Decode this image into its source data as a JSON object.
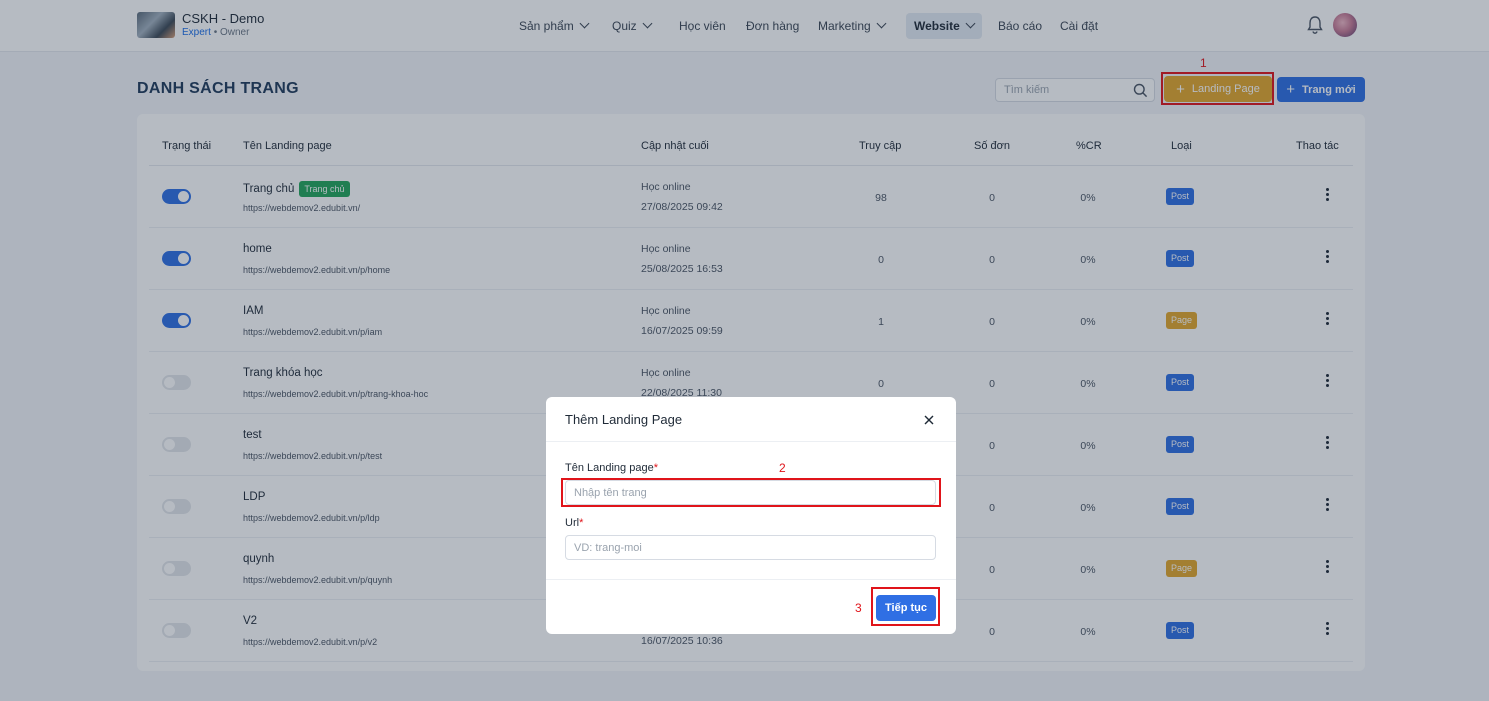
{
  "header": {
    "brand_name": "CSKH - Demo",
    "brand_plan": "Expert",
    "brand_role": "• Owner",
    "nav": [
      {
        "label": "Sản phẩm",
        "has_dropdown": true,
        "active": false
      },
      {
        "label": "Quiz",
        "has_dropdown": true,
        "active": false
      },
      {
        "label": "Học viên",
        "has_dropdown": false,
        "active": false
      },
      {
        "label": "Đơn hàng",
        "has_dropdown": false,
        "active": false
      },
      {
        "label": "Marketing",
        "has_dropdown": true,
        "active": false
      },
      {
        "label": "Website",
        "has_dropdown": true,
        "active": true
      },
      {
        "label": "Báo cáo",
        "has_dropdown": false,
        "active": false
      },
      {
        "label": "Cài đặt",
        "has_dropdown": false,
        "active": false
      }
    ],
    "icons": {
      "notifications": "bell-icon",
      "user": "avatar"
    }
  },
  "page": {
    "title": "DANH SÁCH TRANG",
    "search_placeholder": "Tìm kiếm",
    "btn_landing_page": "Landing Page",
    "btn_new_page": "Trang mới"
  },
  "table": {
    "columns": [
      "Trạng thái",
      "Tên Landing page",
      "Cập nhật cuối",
      "Truy cập",
      "Số đơn",
      "%CR",
      "Loại",
      "Thao tác"
    ],
    "rows": [
      {
        "enabled": true,
        "name": "Trang chủ",
        "badge": "Trang chủ",
        "url": "https://webdemov2.edubit.vn/",
        "updated_by": "Học online",
        "updated_at": "27/08/2025 09:42",
        "visits": "98",
        "orders": "0",
        "cr": "0%",
        "type": "Post"
      },
      {
        "enabled": true,
        "name": "home",
        "badge": "",
        "url": "https://webdemov2.edubit.vn/p/home",
        "updated_by": "Học online",
        "updated_at": "25/08/2025 16:53",
        "visits": "0",
        "orders": "0",
        "cr": "0%",
        "type": "Post"
      },
      {
        "enabled": true,
        "name": "IAM",
        "badge": "",
        "url": "https://webdemov2.edubit.vn/p/iam",
        "updated_by": "Học online",
        "updated_at": "16/07/2025 09:59",
        "visits": "1",
        "orders": "0",
        "cr": "0%",
        "type": "Page"
      },
      {
        "enabled": false,
        "name": "Trang khóa học",
        "badge": "",
        "url": "https://webdemov2.edubit.vn/p/trang-khoa-hoc",
        "updated_by": "Học online",
        "updated_at": "22/08/2025 11:30",
        "visits": "0",
        "orders": "0",
        "cr": "0%",
        "type": "Post"
      },
      {
        "enabled": false,
        "name": "test",
        "badge": "",
        "url": "https://webdemov2.edubit.vn/p/test",
        "updated_by": "",
        "updated_at": "",
        "visits": "",
        "orders": "0",
        "cr": "0%",
        "type": "Post"
      },
      {
        "enabled": false,
        "name": "LDP",
        "badge": "",
        "url": "https://webdemov2.edubit.vn/p/ldp",
        "updated_by": "",
        "updated_at": "",
        "visits": "",
        "orders": "0",
        "cr": "0%",
        "type": "Post"
      },
      {
        "enabled": false,
        "name": "quynh",
        "badge": "",
        "url": "https://webdemov2.edubit.vn/p/quynh",
        "updated_by": "",
        "updated_at": "",
        "visits": "",
        "orders": "0",
        "cr": "0%",
        "type": "Page"
      },
      {
        "enabled": false,
        "name": "V2",
        "badge": "",
        "url": "https://webdemov2.edubit.vn/p/v2",
        "updated_by": "",
        "updated_at": "16/07/2025 10:36",
        "visits": "",
        "orders": "0",
        "cr": "0%",
        "type": "Post"
      }
    ]
  },
  "modal": {
    "title": "Thêm Landing Page",
    "name_label": "Tên Landing page",
    "name_placeholder": "Nhập tên trang",
    "url_label": "Url",
    "url_placeholder": "VD: trang-moi",
    "required_mark": "*",
    "continue_label": "Tiếp tục"
  },
  "annotations": {
    "step1": "1",
    "step2": "2",
    "step3": "3"
  },
  "colors": {
    "primary": "#2f6fe4",
    "warning": "#e4a72c",
    "success": "#22a55a",
    "highlight": "#e0141a",
    "overlay": "rgba(28, 42, 66, 0.32)"
  }
}
